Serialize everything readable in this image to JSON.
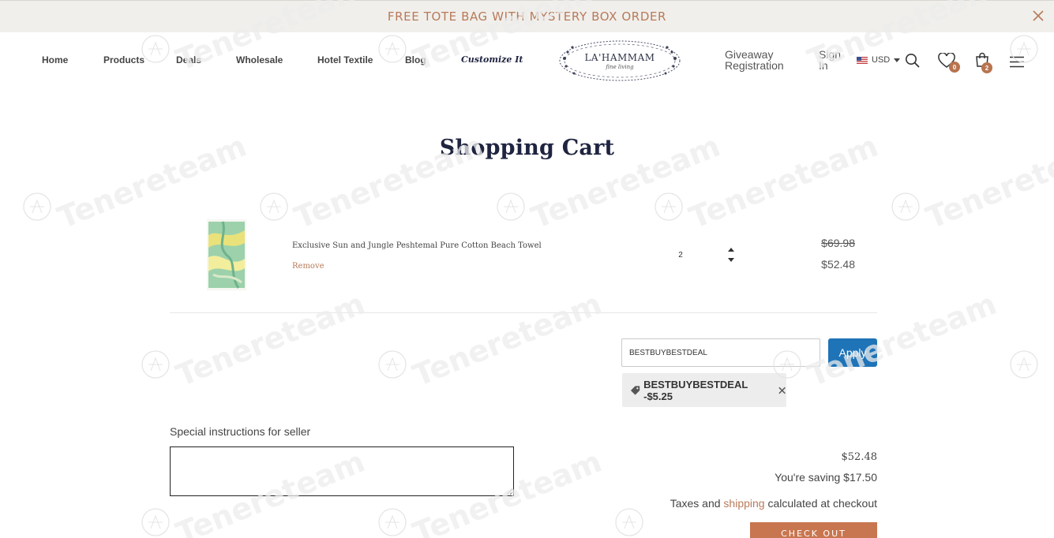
{
  "announcement": {
    "text": "FREE TOTE BAG WITH MYSTERY BOX ORDER"
  },
  "nav": {
    "items": [
      {
        "label": "Home"
      },
      {
        "label": "Products"
      },
      {
        "label": "Deals"
      },
      {
        "label": "Wholesale"
      },
      {
        "label": "Hotel Textile"
      },
      {
        "label": "Blog"
      },
      {
        "label": "Customize It"
      }
    ]
  },
  "brand": {
    "name": "LA'HAMMAM",
    "tagline": "fine living"
  },
  "header": {
    "giveaway_label": "Giveaway Registration",
    "signin_label": "Sign In",
    "currency": "USD",
    "wishlist_count": "0",
    "cart_count": "2"
  },
  "page": {
    "title": "Shopping Cart"
  },
  "cart": {
    "items": [
      {
        "title": "Exclusive Sun and Jungle Peshtemal Pure Cotton Beach Towel",
        "remove_label": "Remove",
        "quantity": "2",
        "price_original": "$69.98",
        "price_final": "$52.48"
      }
    ]
  },
  "discount": {
    "code_value": "BESTBUYBESTDEAL",
    "apply_label": "Apply",
    "applied_tag": "BESTBUYBESTDEAL -$5.25"
  },
  "notes": {
    "label": "Special instructions for seller"
  },
  "totals": {
    "subtotal": "$52.48",
    "saving_text": "You're saving $17.50",
    "taxes_prefix": "Taxes and ",
    "taxes_link": "shipping",
    "taxes_suffix": " calculated at checkout",
    "checkout_label": "CHECK OUT"
  },
  "watermark": {
    "text": "Tenereteam"
  },
  "colors": {
    "accent": "#b87a5a",
    "apply_button": "#1f73b7",
    "checkout_button": "#c8764f",
    "title_navy": "#1f2440"
  }
}
